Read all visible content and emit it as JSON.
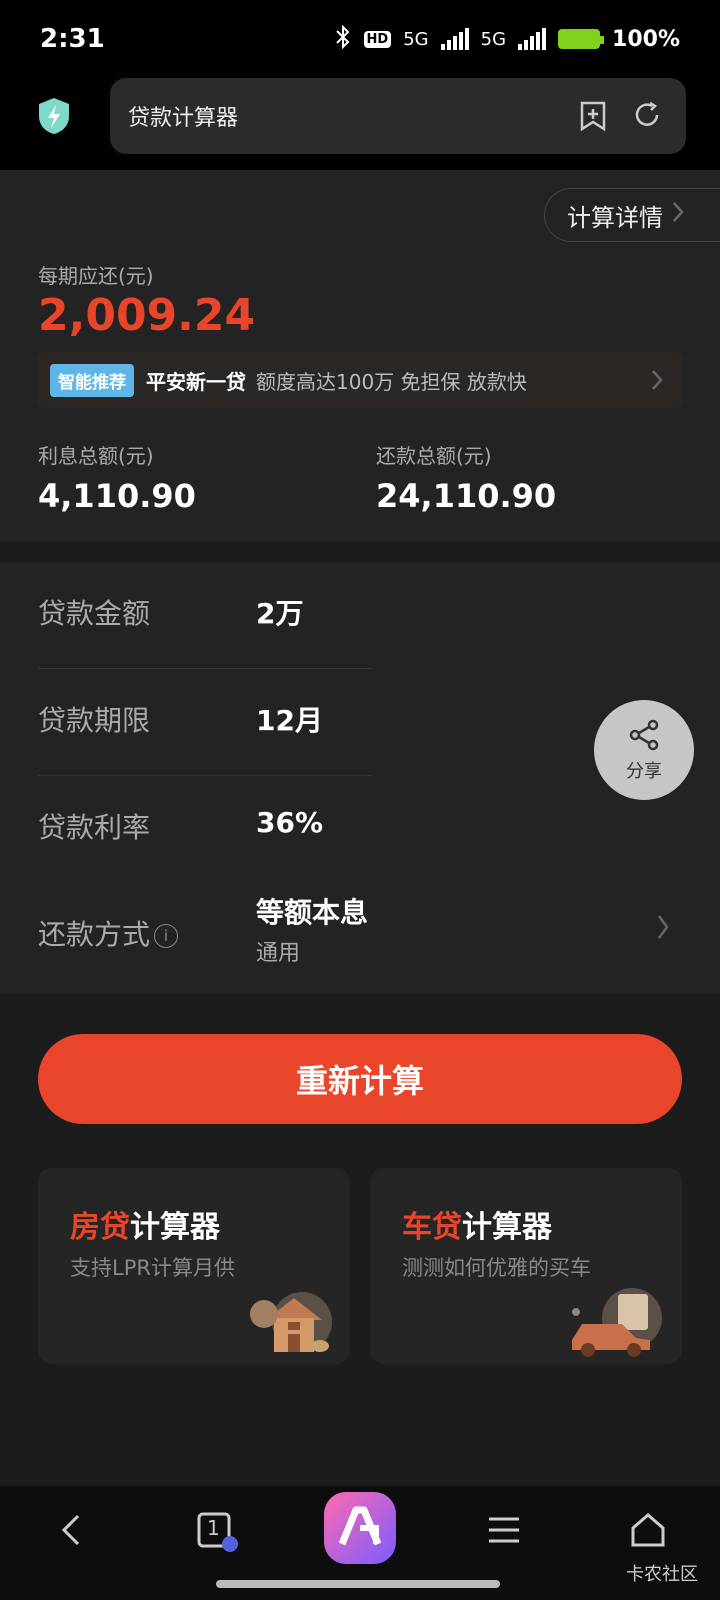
{
  "status_bar": {
    "time": "2:31",
    "hd_label": "HD",
    "network_1": "5G",
    "network_2": "5G",
    "battery_text": "100%"
  },
  "browser": {
    "page_title": "贷款计算器"
  },
  "summary": {
    "detail_button": "计算详情",
    "per_period_label": "每期应还(元)",
    "per_period_value": "2,009.24",
    "per_period_color": "#e8452b",
    "ad_badge": "智能推荐",
    "ad_title": "平安新一贷",
    "ad_desc": "额度高达100万 免担保 放款快",
    "interest_total_label": "利息总额(元)",
    "interest_total_value": "4,110.90",
    "repay_total_label": "还款总额(元)",
    "repay_total_value": "24,110.90"
  },
  "form": {
    "amount_label": "贷款金额",
    "amount_value": "2万",
    "term_label": "贷款期限",
    "term_value": "12月",
    "rate_label": "贷款利率",
    "rate_value": "36%",
    "method_label": "还款方式",
    "method_value": "等额本息",
    "method_sub": "通用"
  },
  "share": {
    "label": "分享"
  },
  "recalc_button": "重新计算",
  "cards": [
    {
      "accent": "房贷",
      "title": "计算器",
      "sub": "支持LPR计算月供",
      "icon": "house-icon"
    },
    {
      "accent": "车贷",
      "title": "计算器",
      "sub": "测测如何优雅的买车",
      "icon": "car-icon"
    }
  ],
  "bottom_nav": {
    "tab_count": "1"
  },
  "watermark": "卡农社区",
  "colors": {
    "accent": "#e8452b",
    "background": "#1c1c1c",
    "panel": "#232323"
  }
}
